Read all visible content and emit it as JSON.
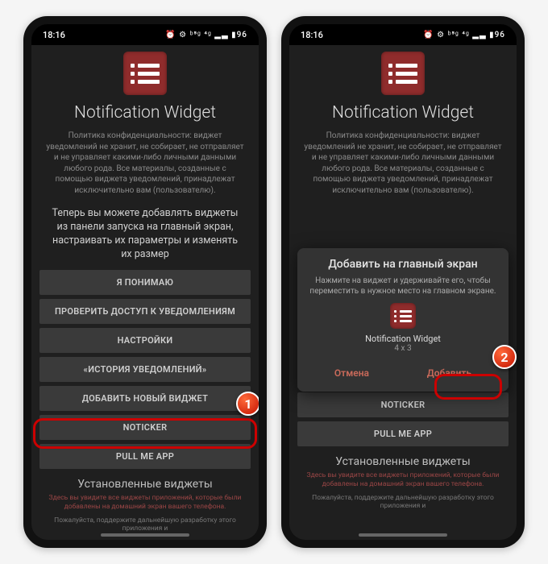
{
  "status": {
    "time": "18:16",
    "icons": "⏰ ⚙ ᵇ⁵ᵍ ⁴ᵍ ▂▃ ▮96"
  },
  "app": {
    "title": "Notification Widget",
    "privacy": "Политика конфиденциальности: виджет уведомлений не хранит, не собирает, не отправляет и не управляет какими-либо личными данными любого рода. Все материалы, созданные с помощью виджета уведомлений, принадлежат исключительно вам (пользователю).",
    "tip": "Теперь вы можете добавлять виджеты из панели запуска на главный экран, настраивать их параметры и изменять их размер"
  },
  "buttons": {
    "ok": "Я ПОНИМАЮ",
    "check": "ПРОВЕРИТЬ ДОСТУП К УВЕДОМЛЕНИЯМ",
    "settings": "НАСТРОЙКИ",
    "history": "«ИСТОРИЯ УВЕДОМЛЕНИЙ»",
    "add": "ДОБАВИТЬ НОВЫЙ ВИДЖЕТ",
    "noticker": "NOTICKER",
    "pull": "PULL ME APP"
  },
  "installed": {
    "title": "Установленные виджеты",
    "hint": "Здесь вы увидите все виджеты приложений, которые были добавлены на домашний экран вашего телефона.",
    "note": "Пожалуйста, поддержите дальнейшую разработку этого приложения и"
  },
  "modal": {
    "title": "Добавить на главный экран",
    "sub": "Нажмите на виджет и удерживайте его, чтобы переместить в нужное место на главном экране.",
    "widget_name": "Notification Widget",
    "widget_size": "4 x 3",
    "cancel": "Отмена",
    "add": "Добавить"
  },
  "markers": {
    "one": "1",
    "two": "2"
  }
}
